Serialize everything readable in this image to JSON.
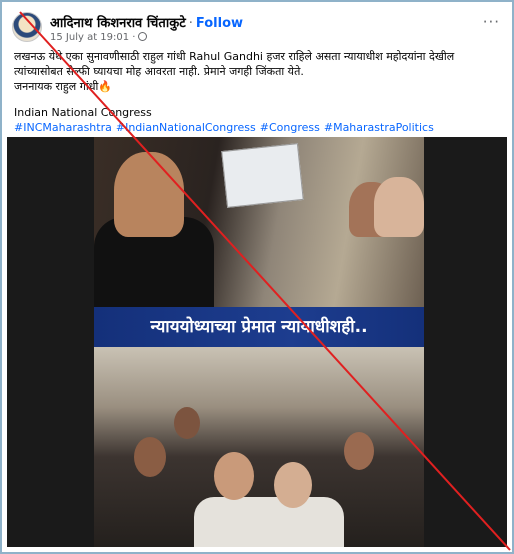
{
  "post": {
    "author": "आदिनाथ किशनराव चिंताकुटे",
    "separator": "·",
    "follow_label": "Follow",
    "timestamp": "15 July at 19:01 ·",
    "more_label": "···",
    "text_line1": "लखनऊ येथे एका सुनावणीसाठी राहुल गांधी Rahul Gandhi हजर राहिले असता न्यायाधीश महोदयांना देखील",
    "text_line2": "त्यांच्यासोबत सेल्फी घ्यायचा मोह आवरता नाही. प्रेमाने जगही जिंकता येते.",
    "text_line3": "जननायक राहुल गांधी🔥",
    "text_line4": "Indian National Congress",
    "hashtags": [
      "#INCMaharashtra",
      "#IndianNationalCongress",
      "#Congress",
      "#MaharastraPolitics"
    ]
  },
  "photo": {
    "banner_text": "न्याययोध्याच्या प्रेमात न्यायाधीशही.."
  },
  "overlay": {
    "cross_color": "#e02020"
  },
  "icons": {
    "avatar": "profile-avatar",
    "privacy": "globe-icon",
    "more": "more-options-icon"
  }
}
